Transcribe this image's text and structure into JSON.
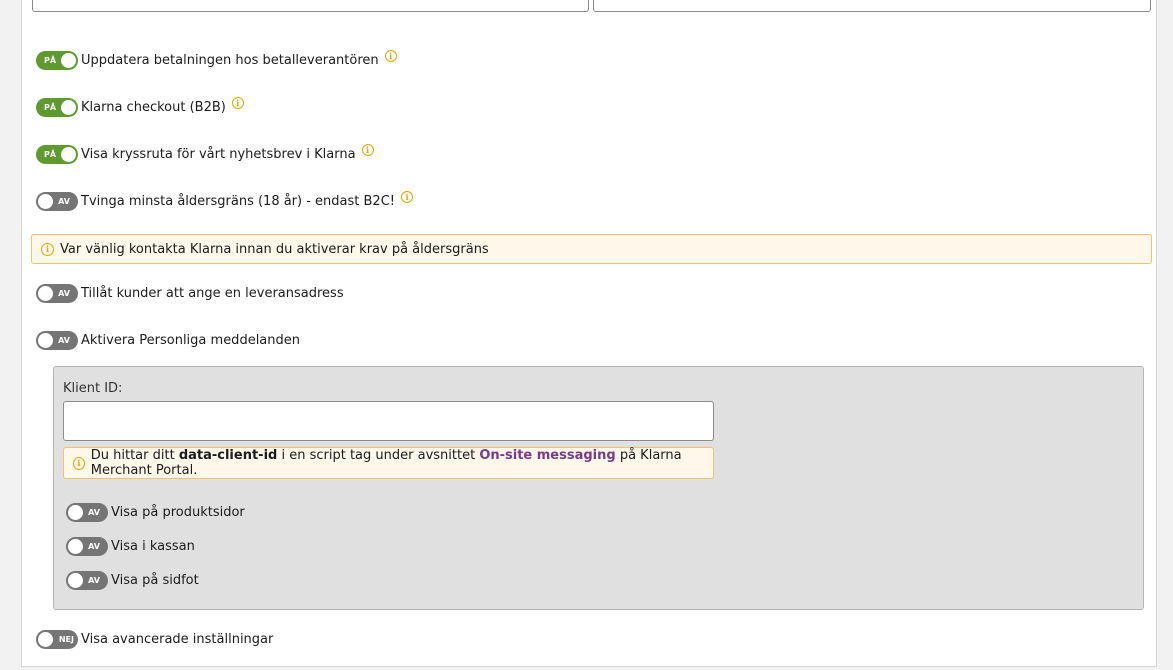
{
  "settings": {
    "update_payment": {
      "state": "PÅ",
      "label": "Uppdatera betalningen hos betalleverantören"
    },
    "klarna_b2b": {
      "state": "PÅ",
      "label": "Klarna checkout (B2B)"
    },
    "newsletter_checkbox": {
      "state": "PÅ",
      "label": "Visa kryssruta för vårt nyhetsbrev i Klarna"
    },
    "age_limit": {
      "state": "AV",
      "label": "Tvinga minsta åldersgräns (18 år) - endast B2C!"
    },
    "age_alert": "Var vänlig kontakta Klarna innan du aktiverar krav på åldersgräns",
    "delivery_address": {
      "state": "AV",
      "label": "Tillåt kunder att ange en leveransadress"
    },
    "personal_messages": {
      "state": "AV",
      "label": "Aktivera Personliga meddelanden"
    },
    "advanced": {
      "state": "NEJ",
      "label": "Visa avancerade inställningar"
    }
  },
  "messaging": {
    "client_id_label": "Klient ID:",
    "client_id_value": "",
    "hint_prefix": "Du hittar ditt ",
    "hint_bold": "data-client-id",
    "hint_middle": " i en script tag under avsnittet ",
    "hint_link": "On-site messaging",
    "hint_suffix": " på Klarna Merchant Portal.",
    "product_pages": {
      "state": "AV",
      "label": "Visa på produktsidor"
    },
    "checkout": {
      "state": "AV",
      "label": "Visa i kassan"
    },
    "footer": {
      "state": "AV",
      "label": "Visa på sidfot"
    }
  },
  "colors": {
    "toggle_on": "#5e9a2d",
    "toggle_off": "#757575",
    "alert_border": "#f0c36d",
    "link": "#7a3b8c"
  },
  "icons": {
    "info": "info-circle-icon"
  }
}
